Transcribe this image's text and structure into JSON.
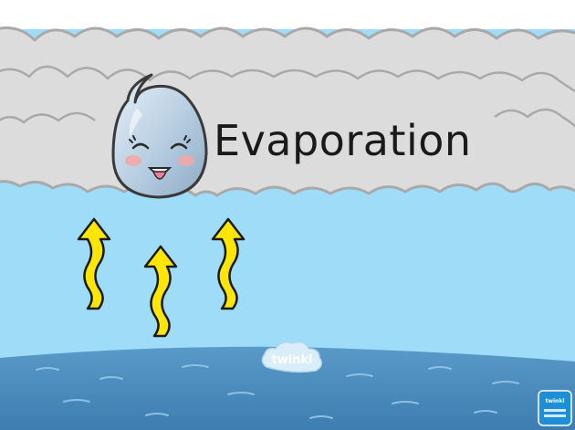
{
  "slide": {
    "title": "Evaporation",
    "logo_text": "twinkl",
    "badge_text": "twinkl"
  },
  "colors": {
    "sky": "#9edcf7",
    "cloud_fill": "#dcdcdc",
    "cloud_outline": "#a9a9a9",
    "water": "#4f90bf",
    "arrow_fill": "#ffe600",
    "arrow_outline": "#1a1a1a",
    "droplet": "#b8cfe0",
    "logo_cloud": "#d9eef8",
    "badge": "#1e8fd6"
  },
  "icons": {
    "droplet": "water-droplet-character-icon",
    "arrows": "wavy-up-arrow-icon",
    "logo": "twinkl-logo-cloud",
    "badge": "twinkl-badge-icon"
  }
}
